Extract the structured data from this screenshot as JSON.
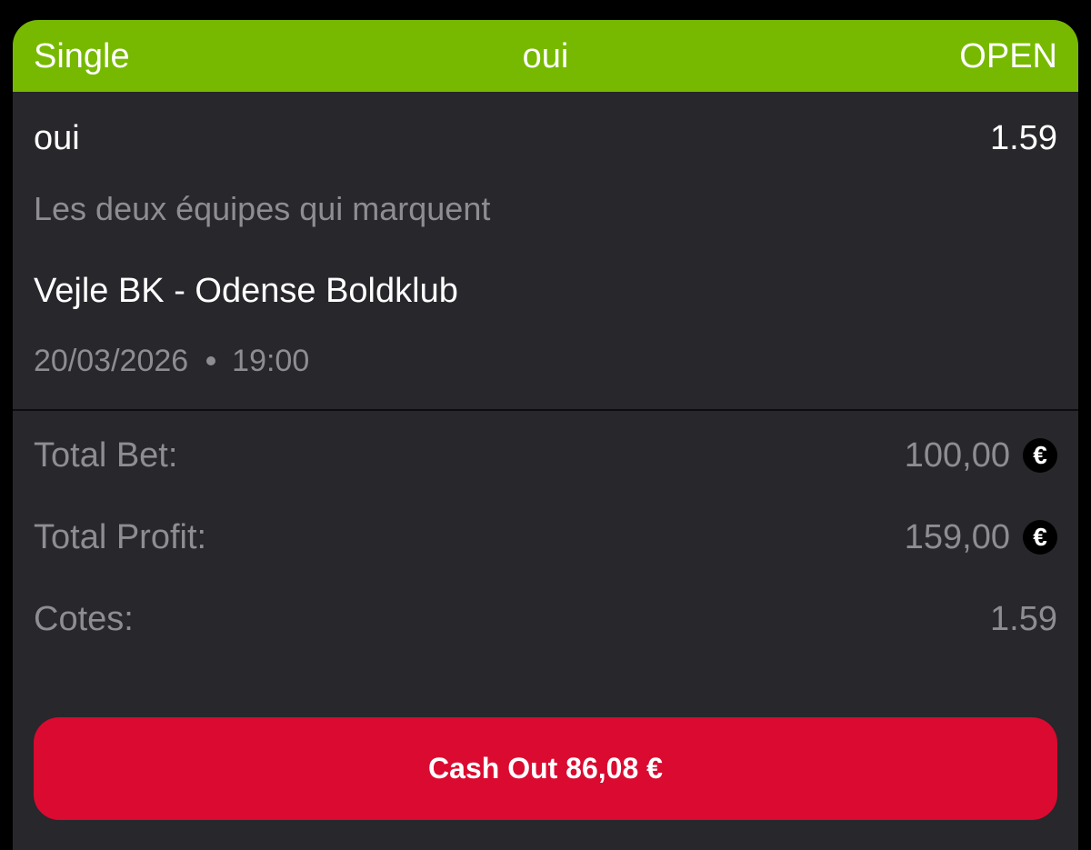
{
  "header": {
    "bet_type": "Single",
    "selection": "oui",
    "status": "OPEN"
  },
  "selection": {
    "name": "oui",
    "odds": "1.59",
    "market": "Les deux équipes qui marquent",
    "event": "Vejle BK - Odense Boldklub",
    "date": "20/03/2026",
    "time": "19:00"
  },
  "summary": {
    "total_bet_label": "Total Bet:",
    "total_bet_value": "100,00",
    "total_profit_label": "Total Profit:",
    "total_profit_value": "159,00",
    "odds_label": "Cotes:",
    "odds_value": "1.59",
    "currency_symbol": "€"
  },
  "cashout_label": "Cash Out 86,08 €",
  "colors": {
    "header_green": "#76b900",
    "card_background": "#27272c",
    "cashout_red": "#db0a30",
    "muted_text": "#8d8d92"
  },
  "icons": {
    "currency": "euro-icon",
    "separator": "dot-separator-icon"
  }
}
